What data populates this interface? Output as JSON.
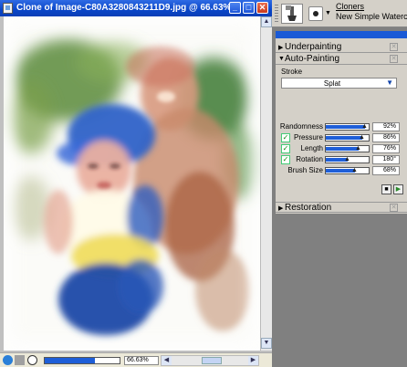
{
  "document_window": {
    "title": "Clone of Image-C80A3280843211D9.jpg @ 66.63%",
    "controls": {
      "minimize": "_",
      "maximize": "□",
      "close": "✕"
    },
    "zoom_value": "66.63%",
    "zoom_fraction": 0.67
  },
  "property_bar": {
    "brush_category": "Cloners",
    "brush_variant": "New Simple Watercolor"
  },
  "palette": {
    "sections": {
      "underpainting": "Underpainting",
      "auto_painting": "Auto-Painting",
      "restoration": "Restoration"
    },
    "stroke_label": "Stroke",
    "stroke_value": "Splat",
    "sliders": [
      {
        "label": "Randomness",
        "value": "92%",
        "fraction": 0.92,
        "checkbox": false
      },
      {
        "label": "Pressure",
        "value": "86%",
        "fraction": 0.86,
        "checkbox": true
      },
      {
        "label": "Length",
        "value": "76%",
        "fraction": 0.76,
        "checkbox": true
      },
      {
        "label": "Rotation",
        "value": "180°",
        "fraction": 0.5,
        "checkbox": true
      },
      {
        "label": "Brush Size",
        "value": "68%",
        "fraction": 0.68,
        "checkbox": false
      }
    ]
  },
  "colors": {
    "title_bar": "#0a46c8",
    "accent_blue": "#1e5ed8",
    "panel_bg": "#d4d0c8",
    "workspace_gray": "#808080"
  }
}
